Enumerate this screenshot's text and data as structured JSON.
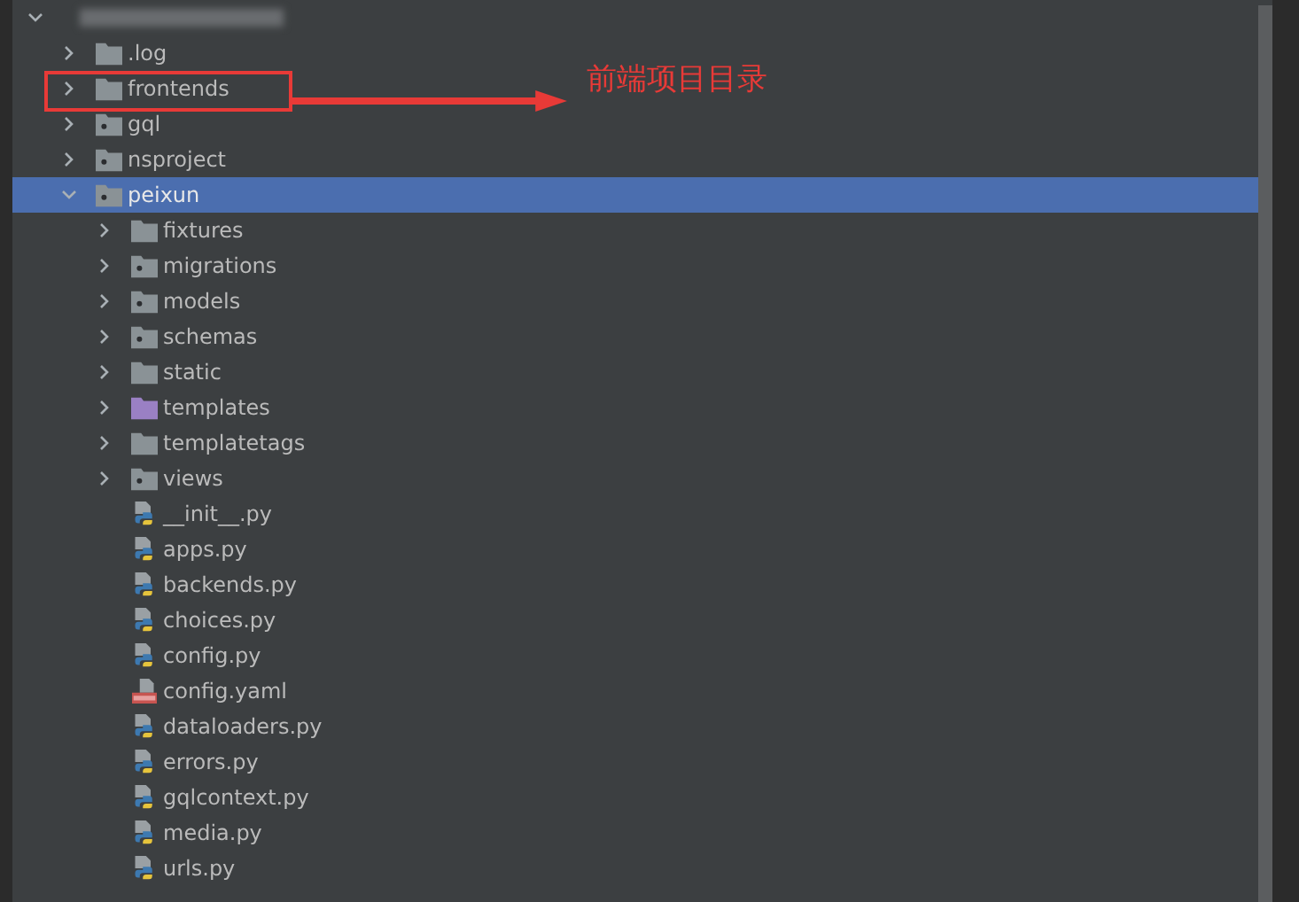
{
  "tree": {
    "expanded": true,
    "children": [
      {
        "label": ".log",
        "kind": "folder",
        "expanded": false,
        "selected": false
      },
      {
        "label": "frontends",
        "kind": "folder",
        "expanded": false,
        "selected": false
      },
      {
        "label": "gql",
        "kind": "module",
        "expanded": false,
        "selected": false
      },
      {
        "label": "nsproject",
        "kind": "module",
        "expanded": false,
        "selected": false
      },
      {
        "label": "peixun",
        "kind": "module",
        "expanded": true,
        "selected": true,
        "children": [
          {
            "label": "fixtures",
            "kind": "folder",
            "expanded": false,
            "selected": false
          },
          {
            "label": "migrations",
            "kind": "module",
            "expanded": false,
            "selected": false
          },
          {
            "label": "models",
            "kind": "module",
            "expanded": false,
            "selected": false
          },
          {
            "label": "schemas",
            "kind": "module",
            "expanded": false,
            "selected": false
          },
          {
            "label": "static",
            "kind": "folder",
            "expanded": false,
            "selected": false
          },
          {
            "label": "templates",
            "kind": "templates",
            "expanded": false,
            "selected": false
          },
          {
            "label": "templatetags",
            "kind": "folder",
            "expanded": false,
            "selected": false
          },
          {
            "label": "views",
            "kind": "module",
            "expanded": false,
            "selected": false
          },
          {
            "label": "__init__.py",
            "kind": "python",
            "selected": false
          },
          {
            "label": "apps.py",
            "kind": "python",
            "selected": false
          },
          {
            "label": "backends.py",
            "kind": "python",
            "selected": false
          },
          {
            "label": "choices.py",
            "kind": "python",
            "selected": false
          },
          {
            "label": "config.py",
            "kind": "python",
            "selected": false
          },
          {
            "label": "config.yaml",
            "kind": "yaml",
            "selected": false
          },
          {
            "label": "dataloaders.py",
            "kind": "python",
            "selected": false
          },
          {
            "label": "errors.py",
            "kind": "python",
            "selected": false
          },
          {
            "label": "gqlcontext.py",
            "kind": "python",
            "selected": false
          },
          {
            "label": "media.py",
            "kind": "python",
            "selected": false
          },
          {
            "label": "urls.py",
            "kind": "python",
            "selected": false
          }
        ]
      }
    ]
  },
  "annotation": {
    "text": "前端项目目录"
  }
}
